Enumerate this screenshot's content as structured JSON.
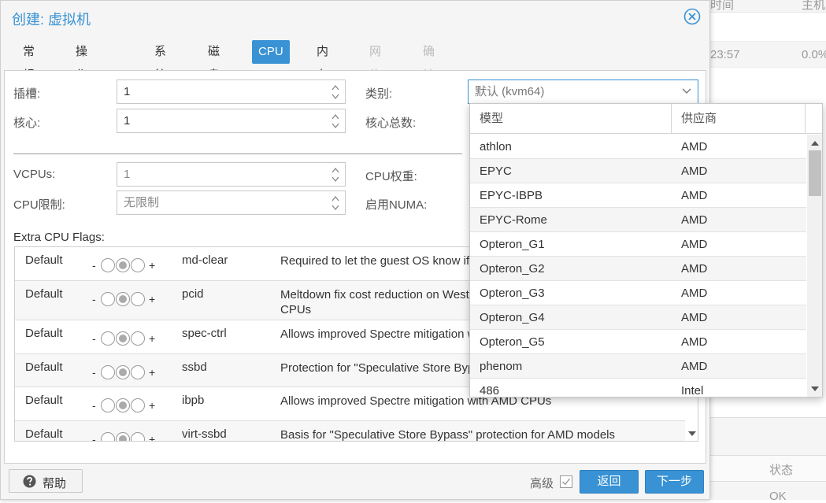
{
  "background": {
    "header_snippet_1": "时间",
    "header_snippet_2": "主机",
    "row_time": "23:57",
    "row_pct": "0.0%",
    "bottom_header": "状态",
    "bottom_value": "OK"
  },
  "dialog": {
    "title": "创建: 虚拟机",
    "tabs": [
      {
        "label": "常规",
        "state": "normal"
      },
      {
        "label": "操作系统",
        "state": "normal"
      },
      {
        "label": "系统",
        "state": "normal"
      },
      {
        "label": "磁盘",
        "state": "normal"
      },
      {
        "label": "CPU",
        "state": "active"
      },
      {
        "label": "内存",
        "state": "normal"
      },
      {
        "label": "网络",
        "state": "disabled"
      },
      {
        "label": "确认",
        "state": "disabled"
      }
    ],
    "accent_color": "#3892d4"
  },
  "form": {
    "sockets_label": "插槽:",
    "sockets_value": "1",
    "cores_label": "核心:",
    "cores_value": "1",
    "type_label": "类别:",
    "type_value": "默认 (kvm64)",
    "total_cores_label": "核心总数:",
    "vcpus_label": "VCPUs:",
    "vcpus_value": "1",
    "cpu_units_label": "CPU权重:",
    "cpu_limit_label": "CPU限制:",
    "cpu_limit_value": "无限制",
    "numa_label": "启用NUMA:",
    "flags_title": "Extra CPU Flags:"
  },
  "flags": [
    {
      "default": "Default",
      "minus": "-",
      "plus": "+",
      "name": "md-clear",
      "desc": "Required to let the guest OS know if MDS is mitigated correctly"
    },
    {
      "default": "Default",
      "minus": "-",
      "plus": "+",
      "name": "pcid",
      "desc": "Meltdown fix cost reduction on Westmere, Sandy-, and IvyBridge Intel CPUs"
    },
    {
      "default": "Default",
      "minus": "-",
      "plus": "+",
      "name": "spec-ctrl",
      "desc": "Allows improved Spectre mitigation with Intel CPUs"
    },
    {
      "default": "Default",
      "minus": "-",
      "plus": "+",
      "name": "ssbd",
      "desc": "Protection for \"Speculative Store Bypass\" for Intel models"
    },
    {
      "default": "Default",
      "minus": "-",
      "plus": "+",
      "name": "ibpb",
      "desc": "Allows improved Spectre mitigation with AMD CPUs"
    },
    {
      "default": "Default",
      "minus": "-",
      "plus": "+",
      "name": "virt-ssbd",
      "desc": "Basis for \"Speculative Store Bypass\" protection for AMD models"
    }
  ],
  "picker": {
    "col_model": "模型",
    "col_vendor": "供应商",
    "rows": [
      {
        "model": "athlon",
        "vendor": "AMD"
      },
      {
        "model": "EPYC",
        "vendor": "AMD"
      },
      {
        "model": "EPYC-IBPB",
        "vendor": "AMD"
      },
      {
        "model": "EPYC-Rome",
        "vendor": "AMD"
      },
      {
        "model": "Opteron_G1",
        "vendor": "AMD"
      },
      {
        "model": "Opteron_G2",
        "vendor": "AMD"
      },
      {
        "model": "Opteron_G3",
        "vendor": "AMD"
      },
      {
        "model": "Opteron_G4",
        "vendor": "AMD"
      },
      {
        "model": "Opteron_G5",
        "vendor": "AMD"
      },
      {
        "model": "phenom",
        "vendor": "AMD"
      },
      {
        "model": "486",
        "vendor": "Intel"
      }
    ]
  },
  "footer": {
    "help_label": "帮助",
    "advanced_label": "高级",
    "back_label": "返回",
    "next_label": "下一步"
  }
}
